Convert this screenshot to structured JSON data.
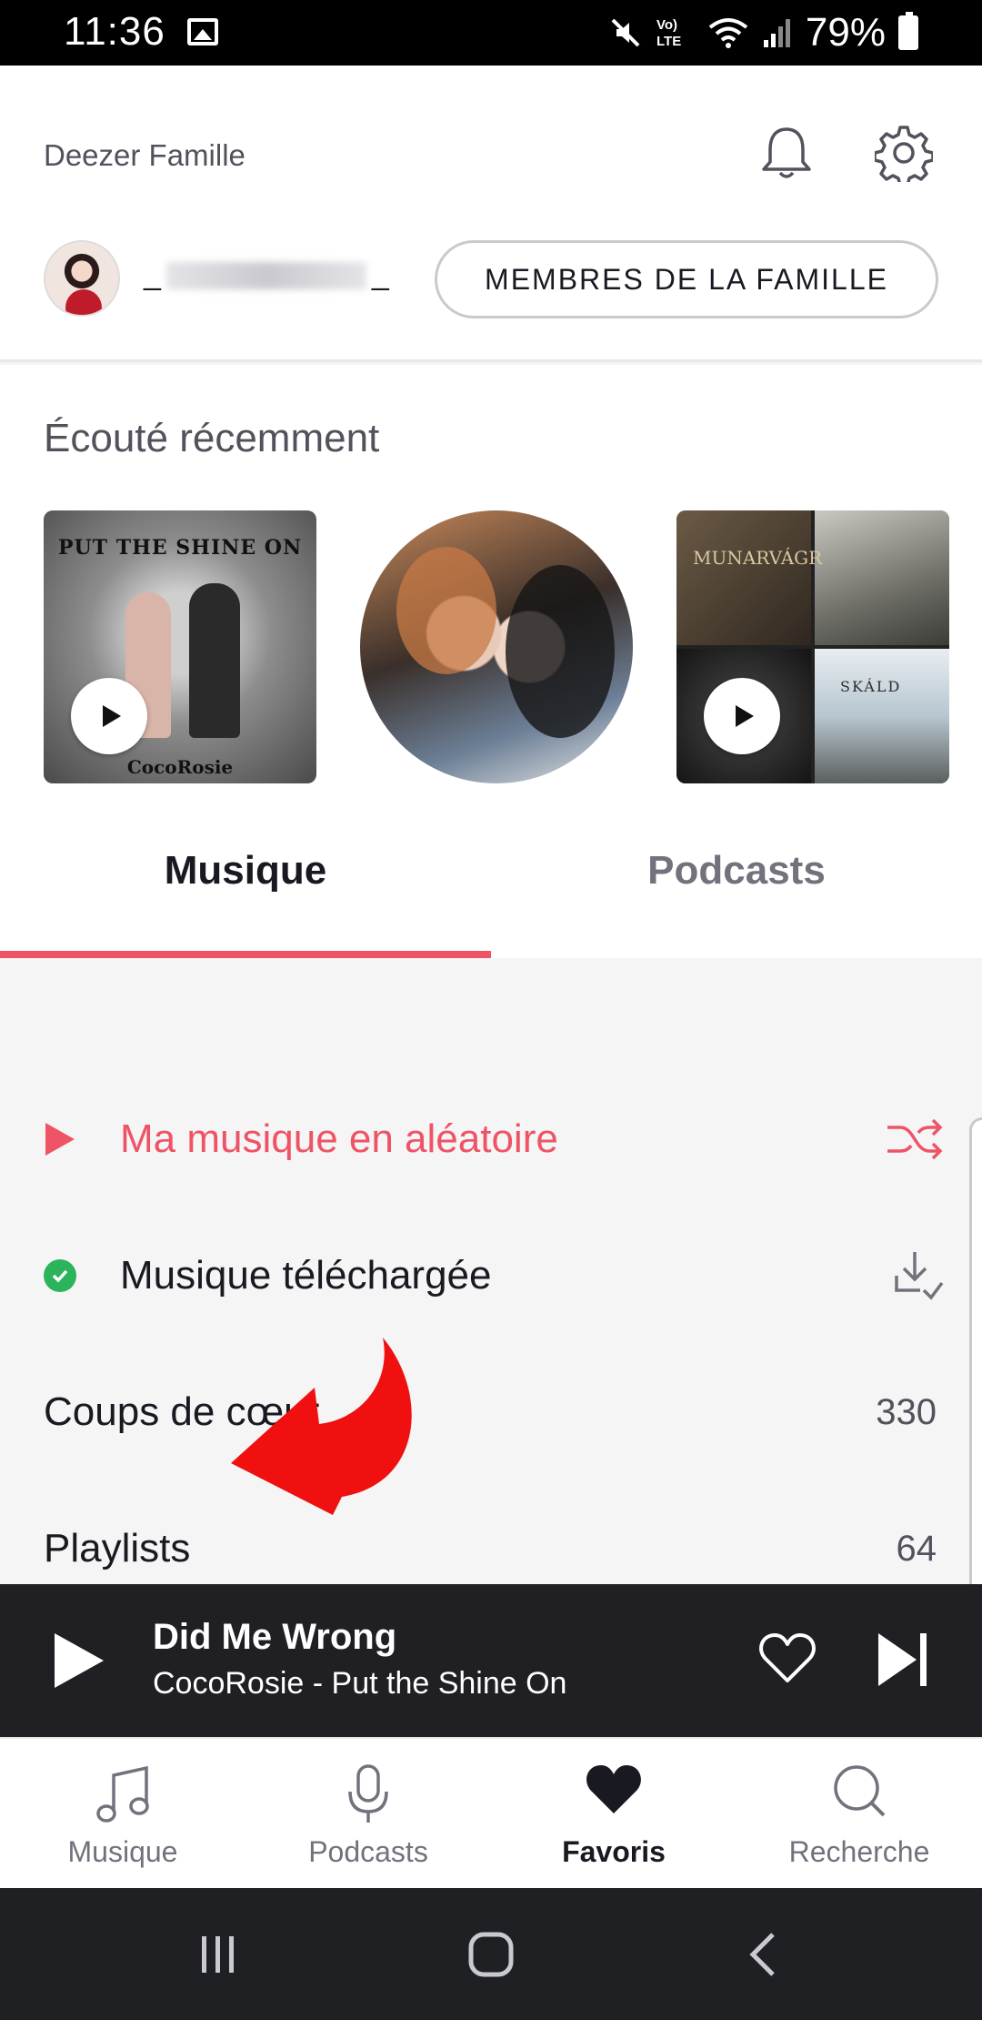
{
  "status_bar": {
    "time": "11:36",
    "battery": "79%",
    "lte_label": "Vo) LTE"
  },
  "header": {
    "brand": "Deezer Famille",
    "username_prefix": "_",
    "username_suffix": "_",
    "family_button": "MEMBRES DE LA FAMILLE"
  },
  "recent": {
    "title": "Écouté récemment",
    "items": [
      {
        "cover_text": "PUT THE SHINE ON",
        "cover_sub": "CocoRosie"
      },
      {
        "cover_text": ""
      },
      {
        "cover_text": "MUNARVÁGR",
        "cover_sub": "SKÁLD"
      }
    ]
  },
  "tabs": {
    "musique": "Musique",
    "podcasts": "Podcasts",
    "active": "Musique"
  },
  "list": {
    "shuffle": "Ma musique en aléatoire",
    "downloaded": "Musique téléchargée",
    "favorites": {
      "label": "Coups de cœur",
      "count": "330"
    },
    "playlists": {
      "label": "Playlists",
      "count": "64"
    }
  },
  "player": {
    "title": "Did Me Wrong",
    "subtitle": "CocoRosie - Put the Shine On"
  },
  "bottom_nav": {
    "items": [
      {
        "label": "Musique",
        "icon": "music-note-icon"
      },
      {
        "label": "Podcasts",
        "icon": "microphone-icon"
      },
      {
        "label": "Favoris",
        "icon": "heart-icon"
      },
      {
        "label": "Recherche",
        "icon": "search-icon"
      }
    ],
    "active": "Favoris"
  },
  "colors": {
    "accent": "#ef5466",
    "success": "#2bb45a",
    "player_bg": "#1f1f24",
    "annotation": "#f01010"
  }
}
